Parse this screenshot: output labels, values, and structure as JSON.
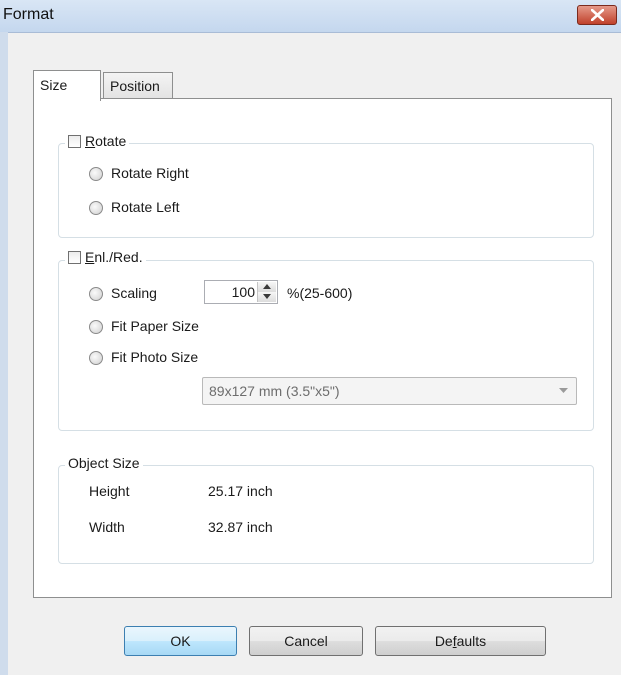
{
  "window": {
    "title": "Format",
    "close_icon": "close-x-icon"
  },
  "tabs": [
    {
      "label": "Size",
      "active": true
    },
    {
      "label": "Position",
      "active": false
    }
  ],
  "rotate": {
    "label_u": "R",
    "label_rest": "otate",
    "checked": false,
    "options": [
      "Rotate Right",
      "Rotate Left"
    ]
  },
  "enlred": {
    "label_u": "E",
    "label_rest": "nl./Red.",
    "checked": false,
    "scaling_label": "Scaling",
    "scaling_value": "100",
    "scaling_range": "%(25-600)",
    "fit_paper": "Fit Paper Size",
    "fit_photo": "Fit Photo Size",
    "photo_size_selected": "89x127 mm (3.5\"x5\")"
  },
  "object_size": {
    "legend": "Object Size",
    "height_label": "Height",
    "height_value": "25.17 inch",
    "width_label": "Width",
    "width_value": "32.87 inch"
  },
  "buttons": {
    "ok": "OK",
    "cancel": "Cancel",
    "defaults_pre": "De",
    "defaults_u": "f",
    "defaults_post": "aults"
  }
}
